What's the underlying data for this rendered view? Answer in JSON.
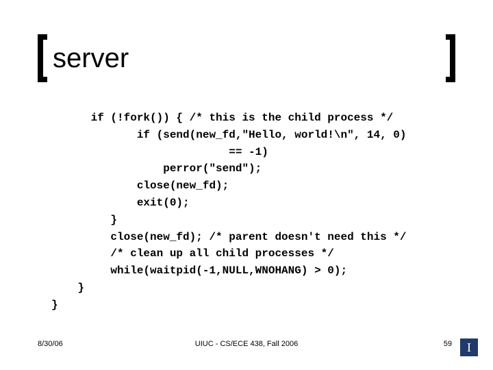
{
  "title": "server",
  "code": "      if (!fork()) { /* this is the child process */\n             if (send(new_fd,\"Hello, world!\\n\", 14, 0)\n                           == -1)\n                 perror(\"send\");\n             close(new_fd);\n             exit(0);\n         }\n         close(new_fd); /* parent doesn't need this */\n         /* clean up all child processes */\n         while(waitpid(-1,NULL,WNOHANG) > 0);\n    }\n}",
  "footer": {
    "date": "8/30/06",
    "center": "UIUC - CS/ECE 438, Fall 2006",
    "page": "59"
  },
  "logo_letter": "I"
}
